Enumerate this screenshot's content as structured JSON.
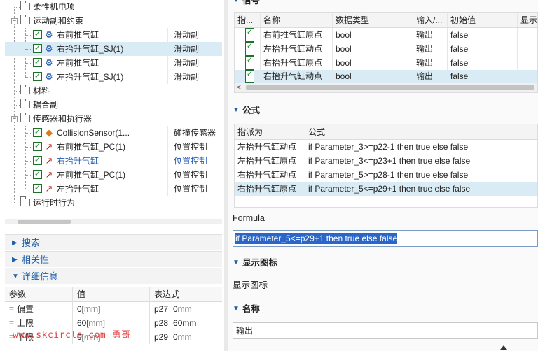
{
  "tree": {
    "rows": [
      {
        "label": "柔性机电项",
        "type": "folder",
        "col2": ""
      },
      {
        "label": "运动副和约束",
        "type": "folder-open",
        "col2": ""
      },
      {
        "label": "右前推气缸",
        "type": "joint",
        "col2": "滑动副"
      },
      {
        "label": "右抬升气缸_SJ(1)",
        "type": "joint",
        "col2": "滑动副"
      },
      {
        "label": "左前推气缸",
        "type": "joint",
        "col2": "滑动副"
      },
      {
        "label": "左抬升气缸_SJ(1)",
        "type": "joint",
        "col2": "滑动副"
      },
      {
        "label": "材料",
        "type": "folder",
        "col2": ""
      },
      {
        "label": "耦合副",
        "type": "folder",
        "col2": ""
      },
      {
        "label": "传感器和执行器",
        "type": "folder-open",
        "col2": ""
      },
      {
        "label": "CollisionSensor(1...",
        "type": "sensor",
        "col2": "碰撞传感器"
      },
      {
        "label": "右前推气缸_PC(1)",
        "type": "position",
        "col2": "位置控制"
      },
      {
        "label": "右抬升气缸",
        "type": "position",
        "col2": "位置控制"
      },
      {
        "label": "左前推气缸_PC(1)",
        "type": "position",
        "col2": "位置控制"
      },
      {
        "label": "左抬升气缸",
        "type": "position",
        "col2": "位置控制"
      },
      {
        "label": "运行时行为",
        "type": "folder",
        "col2": ""
      }
    ]
  },
  "sections": {
    "search": "搜索",
    "relevance": "相关性",
    "details": "详细信息"
  },
  "details": {
    "headers": [
      "参数",
      "值",
      "表达式"
    ],
    "rows": [
      {
        "param": "偏置",
        "value": "0[mm]",
        "expr": "p27=0mm"
      },
      {
        "param": "上限",
        "value": "60[mm]",
        "expr": "p28=60mm"
      },
      {
        "param": "下限",
        "value": "0[mm]",
        "expr": "p29=0mm"
      }
    ]
  },
  "watermark": "www.skcircle.com 勇哥",
  "signals": {
    "title": "信号",
    "headers": [
      "指...",
      "名称",
      "数据类型",
      "输入/...",
      "初始值",
      "显示"
    ],
    "rows": [
      {
        "name": "右前推气缸原点",
        "type": "bool",
        "io": "输出",
        "init": "false"
      },
      {
        "name": "左抬升气缸动点",
        "type": "bool",
        "io": "输出",
        "init": "false"
      },
      {
        "name": "右抬升气缸原点",
        "type": "bool",
        "io": "输出",
        "init": "false"
      },
      {
        "name": "右抬升气缸动点",
        "type": "bool",
        "io": "输出",
        "init": "false"
      }
    ]
  },
  "formula_section": {
    "title": "公式",
    "headers": [
      "指派为",
      "公式"
    ],
    "rows": [
      {
        "assign": "左抬升气缸动点",
        "formula": "if Parameter_3>=p22-1 then true else false"
      },
      {
        "assign": "左抬升气缸原点",
        "formula": "if Parameter_3<=p23+1 then true else false"
      },
      {
        "assign": "右抬升气缸动点",
        "formula": "if Parameter_5>=p28-1 then true else false"
      },
      {
        "assign": "右抬升气缸原点",
        "formula": "if Parameter_5<=p29+1 then true else false"
      }
    ],
    "label": "Formula",
    "value": "if Parameter_5<=p29+1 then true else false"
  },
  "show_icon": {
    "title": "显示图标",
    "text": "显示图标"
  },
  "name_section": {
    "title": "名称",
    "value": "输出"
  }
}
